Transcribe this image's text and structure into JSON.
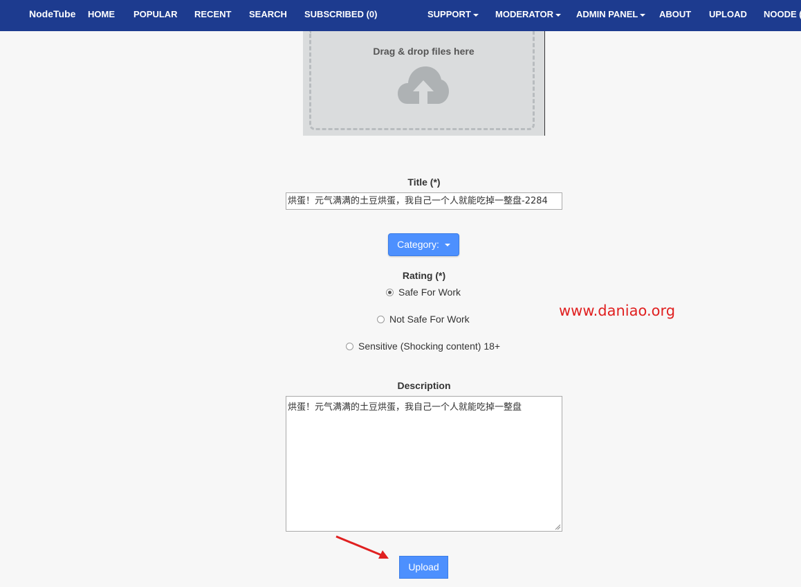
{
  "nav": {
    "brand": "NodeTube",
    "items": [
      {
        "label": "HOME",
        "dropdown": false
      },
      {
        "label": "POPULAR",
        "dropdown": false
      },
      {
        "label": "RECENT",
        "dropdown": false
      },
      {
        "label": "SEARCH",
        "dropdown": false
      },
      {
        "label": "SUBSCRIBED (0)",
        "dropdown": false
      },
      {
        "label": "SUPPORT",
        "dropdown": true
      },
      {
        "label": "MODERATOR",
        "dropdown": true
      },
      {
        "label": "ADMIN PANEL",
        "dropdown": true
      },
      {
        "label": "ABOUT",
        "dropdown": false
      },
      {
        "label": "UPLOAD",
        "dropdown": false
      },
      {
        "label": "NOODE (",
        "dropdown": false
      }
    ]
  },
  "dropzone": {
    "text": "Drag & drop files here",
    "icon": "cloud-upload-icon"
  },
  "form": {
    "title_label": "Title (*)",
    "title_value": "烘蛋！元气满满的土豆烘蛋，我自己一个人就能吃掉一整盘-2284",
    "category_button": "Category:",
    "rating_label": "Rating (*)",
    "rating_options": [
      {
        "label": "Safe For Work",
        "checked": true
      },
      {
        "label": "Not Safe For Work",
        "checked": false
      },
      {
        "label": "Sensitive (Shocking content) 18+",
        "checked": false
      }
    ],
    "description_label": "Description",
    "description_value": "烘蛋！元气满满的土豆烘蛋，我自己一个人就能吃掉一整盘",
    "upload_button": "Upload"
  },
  "watermark": "www.daniao.org",
  "colors": {
    "navbar": "#1d3b8f",
    "button": "#4d90fe",
    "arrow": "#e02020"
  }
}
